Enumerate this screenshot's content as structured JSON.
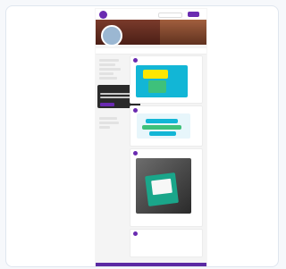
{
  "site": {
    "brand": "",
    "search_placeholder": "",
    "top_button": ""
  },
  "profile": {
    "name": ""
  },
  "tabs": [
    {
      "label": ""
    },
    {
      "label": ""
    },
    {
      "label": ""
    }
  ],
  "popup": {
    "title": "",
    "close_glyph": "×"
  },
  "posts": [
    {
      "title": ""
    },
    {
      "title": ""
    },
    {
      "title": ""
    },
    {
      "title": ""
    }
  ],
  "colors": {
    "brand_purple": "#6a2bb1",
    "cyan": "#12b6d6",
    "yellow": "#ffe600",
    "green": "#3ec17b"
  }
}
